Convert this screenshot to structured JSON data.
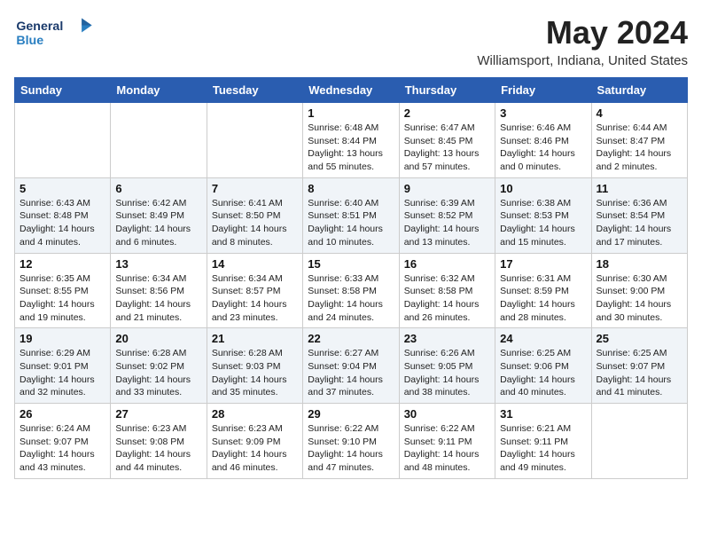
{
  "header": {
    "logo_general": "General",
    "logo_blue": "Blue",
    "month_title": "May 2024",
    "location": "Williamsport, Indiana, United States"
  },
  "columns": [
    "Sunday",
    "Monday",
    "Tuesday",
    "Wednesday",
    "Thursday",
    "Friday",
    "Saturday"
  ],
  "weeks": [
    [
      {
        "day": "",
        "sunrise": "",
        "sunset": "",
        "daylight": ""
      },
      {
        "day": "",
        "sunrise": "",
        "sunset": "",
        "daylight": ""
      },
      {
        "day": "",
        "sunrise": "",
        "sunset": "",
        "daylight": ""
      },
      {
        "day": "1",
        "sunrise": "Sunrise: 6:48 AM",
        "sunset": "Sunset: 8:44 PM",
        "daylight": "Daylight: 13 hours and 55 minutes."
      },
      {
        "day": "2",
        "sunrise": "Sunrise: 6:47 AM",
        "sunset": "Sunset: 8:45 PM",
        "daylight": "Daylight: 13 hours and 57 minutes."
      },
      {
        "day": "3",
        "sunrise": "Sunrise: 6:46 AM",
        "sunset": "Sunset: 8:46 PM",
        "daylight": "Daylight: 14 hours and 0 minutes."
      },
      {
        "day": "4",
        "sunrise": "Sunrise: 6:44 AM",
        "sunset": "Sunset: 8:47 PM",
        "daylight": "Daylight: 14 hours and 2 minutes."
      }
    ],
    [
      {
        "day": "5",
        "sunrise": "Sunrise: 6:43 AM",
        "sunset": "Sunset: 8:48 PM",
        "daylight": "Daylight: 14 hours and 4 minutes."
      },
      {
        "day": "6",
        "sunrise": "Sunrise: 6:42 AM",
        "sunset": "Sunset: 8:49 PM",
        "daylight": "Daylight: 14 hours and 6 minutes."
      },
      {
        "day": "7",
        "sunrise": "Sunrise: 6:41 AM",
        "sunset": "Sunset: 8:50 PM",
        "daylight": "Daylight: 14 hours and 8 minutes."
      },
      {
        "day": "8",
        "sunrise": "Sunrise: 6:40 AM",
        "sunset": "Sunset: 8:51 PM",
        "daylight": "Daylight: 14 hours and 10 minutes."
      },
      {
        "day": "9",
        "sunrise": "Sunrise: 6:39 AM",
        "sunset": "Sunset: 8:52 PM",
        "daylight": "Daylight: 14 hours and 13 minutes."
      },
      {
        "day": "10",
        "sunrise": "Sunrise: 6:38 AM",
        "sunset": "Sunset: 8:53 PM",
        "daylight": "Daylight: 14 hours and 15 minutes."
      },
      {
        "day": "11",
        "sunrise": "Sunrise: 6:36 AM",
        "sunset": "Sunset: 8:54 PM",
        "daylight": "Daylight: 14 hours and 17 minutes."
      }
    ],
    [
      {
        "day": "12",
        "sunrise": "Sunrise: 6:35 AM",
        "sunset": "Sunset: 8:55 PM",
        "daylight": "Daylight: 14 hours and 19 minutes."
      },
      {
        "day": "13",
        "sunrise": "Sunrise: 6:34 AM",
        "sunset": "Sunset: 8:56 PM",
        "daylight": "Daylight: 14 hours and 21 minutes."
      },
      {
        "day": "14",
        "sunrise": "Sunrise: 6:34 AM",
        "sunset": "Sunset: 8:57 PM",
        "daylight": "Daylight: 14 hours and 23 minutes."
      },
      {
        "day": "15",
        "sunrise": "Sunrise: 6:33 AM",
        "sunset": "Sunset: 8:58 PM",
        "daylight": "Daylight: 14 hours and 24 minutes."
      },
      {
        "day": "16",
        "sunrise": "Sunrise: 6:32 AM",
        "sunset": "Sunset: 8:58 PM",
        "daylight": "Daylight: 14 hours and 26 minutes."
      },
      {
        "day": "17",
        "sunrise": "Sunrise: 6:31 AM",
        "sunset": "Sunset: 8:59 PM",
        "daylight": "Daylight: 14 hours and 28 minutes."
      },
      {
        "day": "18",
        "sunrise": "Sunrise: 6:30 AM",
        "sunset": "Sunset: 9:00 PM",
        "daylight": "Daylight: 14 hours and 30 minutes."
      }
    ],
    [
      {
        "day": "19",
        "sunrise": "Sunrise: 6:29 AM",
        "sunset": "Sunset: 9:01 PM",
        "daylight": "Daylight: 14 hours and 32 minutes."
      },
      {
        "day": "20",
        "sunrise": "Sunrise: 6:28 AM",
        "sunset": "Sunset: 9:02 PM",
        "daylight": "Daylight: 14 hours and 33 minutes."
      },
      {
        "day": "21",
        "sunrise": "Sunrise: 6:28 AM",
        "sunset": "Sunset: 9:03 PM",
        "daylight": "Daylight: 14 hours and 35 minutes."
      },
      {
        "day": "22",
        "sunrise": "Sunrise: 6:27 AM",
        "sunset": "Sunset: 9:04 PM",
        "daylight": "Daylight: 14 hours and 37 minutes."
      },
      {
        "day": "23",
        "sunrise": "Sunrise: 6:26 AM",
        "sunset": "Sunset: 9:05 PM",
        "daylight": "Daylight: 14 hours and 38 minutes."
      },
      {
        "day": "24",
        "sunrise": "Sunrise: 6:25 AM",
        "sunset": "Sunset: 9:06 PM",
        "daylight": "Daylight: 14 hours and 40 minutes."
      },
      {
        "day": "25",
        "sunrise": "Sunrise: 6:25 AM",
        "sunset": "Sunset: 9:07 PM",
        "daylight": "Daylight: 14 hours and 41 minutes."
      }
    ],
    [
      {
        "day": "26",
        "sunrise": "Sunrise: 6:24 AM",
        "sunset": "Sunset: 9:07 PM",
        "daylight": "Daylight: 14 hours and 43 minutes."
      },
      {
        "day": "27",
        "sunrise": "Sunrise: 6:23 AM",
        "sunset": "Sunset: 9:08 PM",
        "daylight": "Daylight: 14 hours and 44 minutes."
      },
      {
        "day": "28",
        "sunrise": "Sunrise: 6:23 AM",
        "sunset": "Sunset: 9:09 PM",
        "daylight": "Daylight: 14 hours and 46 minutes."
      },
      {
        "day": "29",
        "sunrise": "Sunrise: 6:22 AM",
        "sunset": "Sunset: 9:10 PM",
        "daylight": "Daylight: 14 hours and 47 minutes."
      },
      {
        "day": "30",
        "sunrise": "Sunrise: 6:22 AM",
        "sunset": "Sunset: 9:11 PM",
        "daylight": "Daylight: 14 hours and 48 minutes."
      },
      {
        "day": "31",
        "sunrise": "Sunrise: 6:21 AM",
        "sunset": "Sunset: 9:11 PM",
        "daylight": "Daylight: 14 hours and 49 minutes."
      },
      {
        "day": "",
        "sunrise": "",
        "sunset": "",
        "daylight": ""
      }
    ]
  ]
}
